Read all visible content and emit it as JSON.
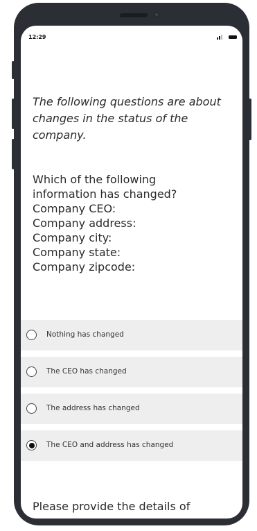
{
  "status_bar": {
    "time": "12:29"
  },
  "survey": {
    "intro": "The following questions are about changes in the status of the company.",
    "question_lines": [
      "Which of the following",
      "information has changed?",
      "Company CEO:",
      "Company address:",
      "Company city:",
      "Company state:",
      "Company zipcode:"
    ],
    "options": [
      {
        "label": "Nothing has changed",
        "selected": false
      },
      {
        "label": "The CEO has changed",
        "selected": false
      },
      {
        "label": "The address has changed",
        "selected": false
      },
      {
        "label": "The CEO and address has changed",
        "selected": true
      }
    ],
    "followup": "Please provide the details of"
  },
  "icons": {
    "signal": "signal-icon",
    "battery": "battery-icon"
  }
}
